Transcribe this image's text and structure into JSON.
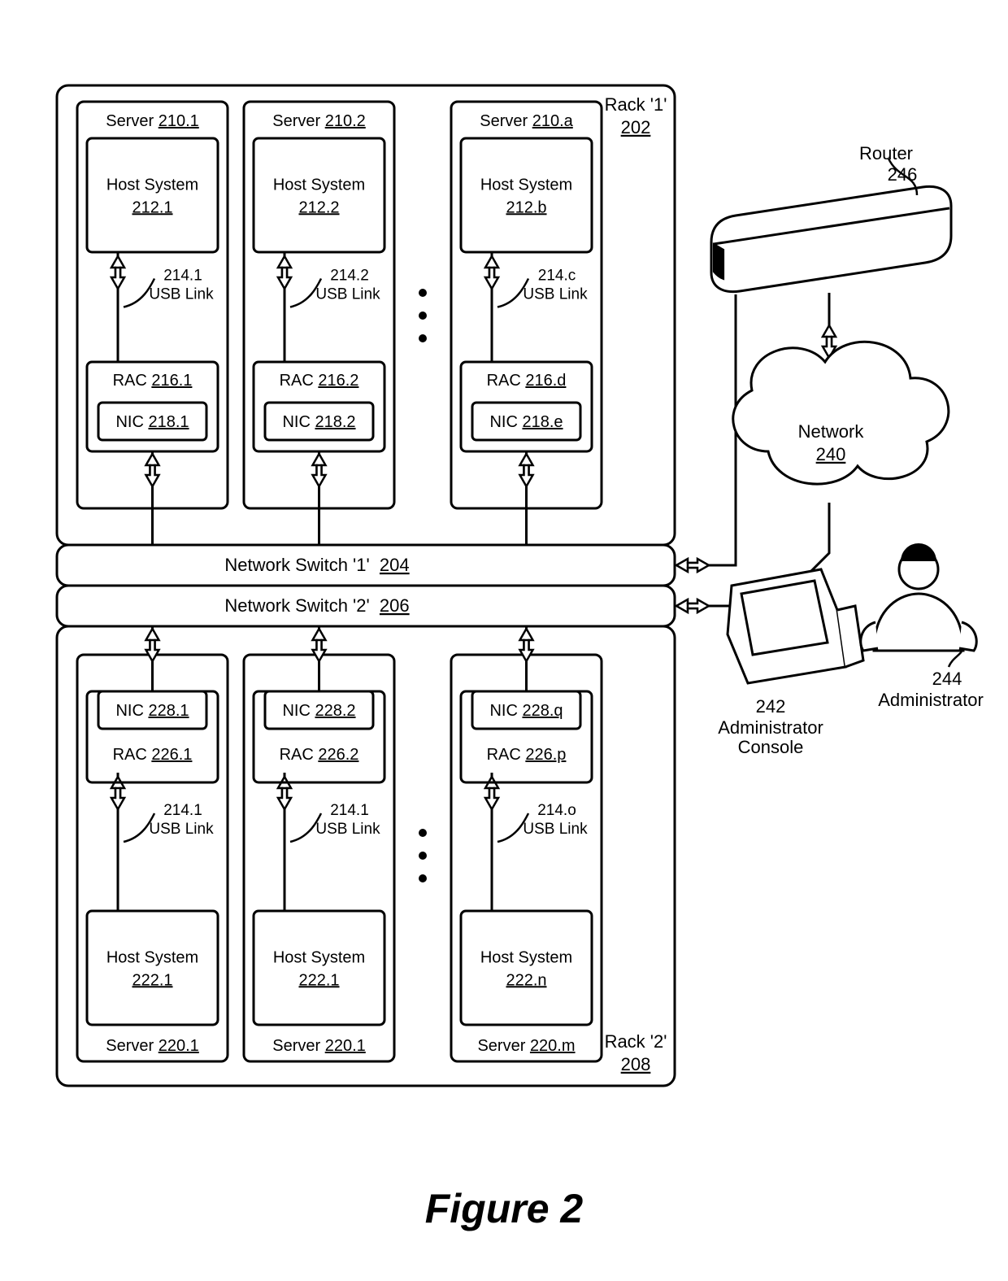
{
  "figure": {
    "caption": "Figure 2"
  },
  "rack1": {
    "label": "Rack '1'",
    "ref": "202"
  },
  "rack2": {
    "label": "Rack '2'",
    "ref": "208"
  },
  "switch1": {
    "label": "Network Switch '1'",
    "ref": "204"
  },
  "switch2": {
    "label": "Network Switch '2'",
    "ref": "206"
  },
  "router": {
    "label": "Router",
    "ref": "246"
  },
  "network": {
    "label": "Network",
    "ref": "240"
  },
  "admin": {
    "console_label": "Administrator\nConsole",
    "console_ref": "242",
    "person_label": "Administrator",
    "person_ref": "244"
  },
  "servers_top": [
    {
      "server": {
        "label": "Server",
        "ref": "210.1"
      },
      "host": {
        "label": "Host System",
        "ref": "212.1"
      },
      "usb": {
        "ref": "214.1",
        "label": "USB Link"
      },
      "rac": {
        "label": "RAC",
        "ref": "216.1"
      },
      "nic": {
        "label": "NIC",
        "ref": "218.1"
      }
    },
    {
      "server": {
        "label": "Server",
        "ref": "210.2"
      },
      "host": {
        "label": "Host System",
        "ref": "212.2"
      },
      "usb": {
        "ref": "214.2",
        "label": "USB Link"
      },
      "rac": {
        "label": "RAC",
        "ref": "216.2"
      },
      "nic": {
        "label": "NIC",
        "ref": "218.2"
      }
    },
    {
      "server": {
        "label": "Server",
        "ref": "210.a"
      },
      "host": {
        "label": "Host System",
        "ref": "212.b"
      },
      "usb": {
        "ref": "214.c",
        "label": "USB Link"
      },
      "rac": {
        "label": "RAC",
        "ref": "216.d"
      },
      "nic": {
        "label": "NIC",
        "ref": "218.e"
      }
    }
  ],
  "servers_bottom": [
    {
      "server": {
        "label": "Server",
        "ref": "220.1"
      },
      "host": {
        "label": "Host System",
        "ref": "222.1"
      },
      "usb": {
        "ref": "214.1",
        "label": "USB Link"
      },
      "rac": {
        "label": "RAC",
        "ref": "226.1"
      },
      "nic": {
        "label": "NIC",
        "ref": "228.1"
      }
    },
    {
      "server": {
        "label": "Server",
        "ref": "220.1"
      },
      "host": {
        "label": "Host System",
        "ref": "222.1"
      },
      "usb": {
        "ref": "214.1",
        "label": "USB Link"
      },
      "rac": {
        "label": "RAC",
        "ref": "226.2"
      },
      "nic": {
        "label": "NIC",
        "ref": "228.2"
      }
    },
    {
      "server": {
        "label": "Server",
        "ref": "220.m"
      },
      "host": {
        "label": "Host System",
        "ref": "222.n"
      },
      "usb": {
        "ref": "214.o",
        "label": "USB Link"
      },
      "rac": {
        "label": "RAC",
        "ref": "226.p"
      },
      "nic": {
        "label": "NIC",
        "ref": "228.q"
      }
    }
  ]
}
